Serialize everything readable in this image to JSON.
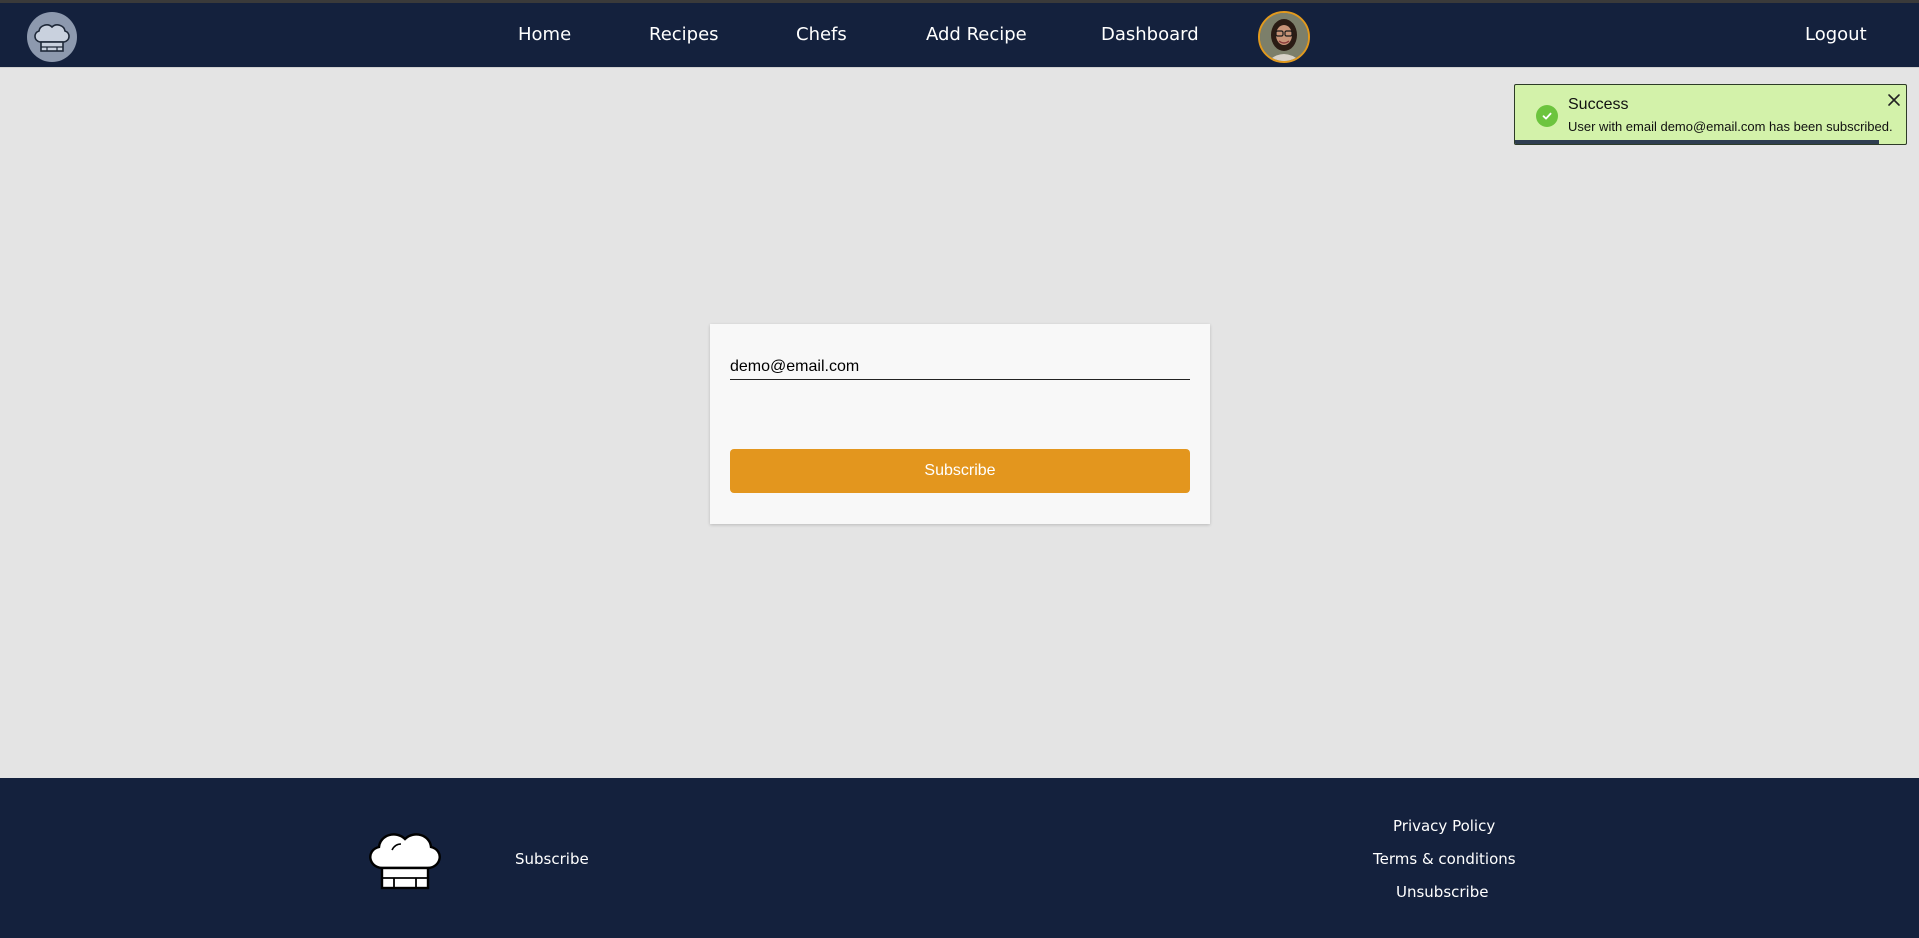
{
  "navbar": {
    "links": {
      "home": "Home",
      "recipes": "Recipes",
      "chefs": "Chefs",
      "add_recipe": "Add Recipe",
      "dashboard": "Dashboard"
    },
    "logout": "Logout"
  },
  "subscribe_form": {
    "email_value": "demo@email.com",
    "button_label": "Subscribe"
  },
  "toast": {
    "title": "Success",
    "message": "User with email demo@email.com has been subscribed.",
    "type": "success",
    "progress_remaining": 0.93
  },
  "footer": {
    "subscribe": "Subscribe",
    "privacy_policy": "Privacy Policy",
    "terms": "Terms & conditions",
    "unsubscribe": "Unsubscribe"
  },
  "colors": {
    "navy": "#14213d",
    "accent_orange": "#e3961e",
    "toast_bg": "#d3f2aa",
    "success_green": "#6cc43e",
    "page_bg": "#e4e4e4"
  },
  "icons": {
    "brand": "chef-hat-icon",
    "toast_status": "check-circle-icon",
    "toast_close": "close-icon",
    "footer_brand": "chef-hat-icon"
  }
}
